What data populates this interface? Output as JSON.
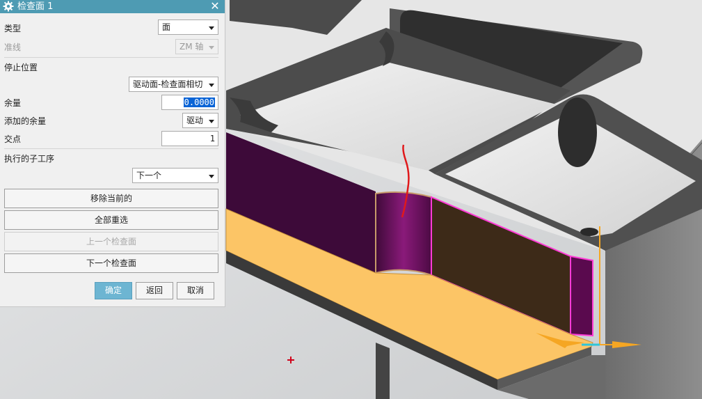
{
  "dialog": {
    "title": "检查面 1",
    "type_label": "类型",
    "type_value": "面",
    "guide_label": "准线",
    "guide_value": "ZM 轴",
    "stop_position_label": "停止位置",
    "stop_position_value": "驱动面-检查面相切",
    "stock_label": "余量",
    "stock_value": "0.0000",
    "added_stock_label": "添加的余量",
    "added_stock_value": "驱动",
    "intersection_label": "交点",
    "intersection_value": "1",
    "subop_label": "执行的子工序",
    "subop_value": "下一个",
    "remove_current": "移除当前的",
    "reselect_all": "全部重选",
    "prev_check_face": "上一个检查面",
    "next_check_face": "下一个检查面",
    "ok": "确定",
    "back": "返回",
    "cancel": "取消"
  },
  "colors": {
    "title_bar": "#4e9bb3",
    "ok_button": "#6db5d2",
    "selected_face_purple": "#5a0a4e",
    "selected_face_brown": "#3d2a18",
    "floor_orange": "#fcc566",
    "highlight_pink": "#ff3bd6",
    "tool_path_red": "#e0191b",
    "axis_orange": "#f5a623"
  },
  "icons": {
    "title": "gear-icon",
    "close": "close-icon",
    "cursor": "crosshair-icon"
  }
}
